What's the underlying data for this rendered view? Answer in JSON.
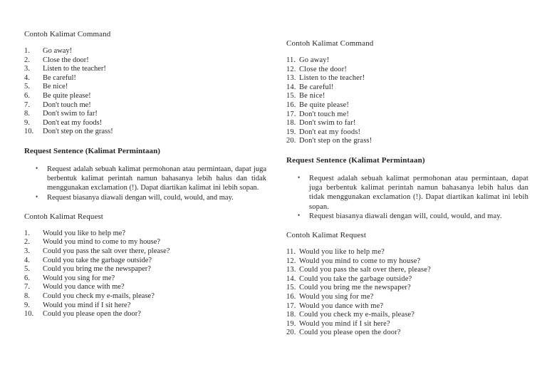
{
  "document": {
    "background_color": "#ffffff",
    "text_color": "#262626"
  },
  "columns": [
    {
      "id": "left",
      "command_heading": "Contoh Kalimat Command",
      "command_items": [
        {
          "number": "1.",
          "text": "Go away!"
        },
        {
          "number": "2.",
          "text": "Close the door!"
        },
        {
          "number": "3.",
          "text": "Listen to the teacher!"
        },
        {
          "number": "4.",
          "text": "Be careful!"
        },
        {
          "number": "5.",
          "text": "Be nice!"
        },
        {
          "number": "6.",
          "text": "Be quite please!"
        },
        {
          "number": "7.",
          "text": "Don't touch me!"
        },
        {
          "number": "8.",
          "text": "Don't swim to far!"
        },
        {
          "number": "9.",
          "text": "Don't eat my foods!"
        },
        {
          "number": "10.",
          "text": "Don't step on the grass!"
        }
      ],
      "request_heading": "Request Sentence (Kalimat Permintaan)",
      "request_bullets": [
        "Request adalah sebuah kalimat permohonan atau permintaan, dapat juga berbentuk kalimat perintah namun bahasanya lebih halus dan tidak menggunakan exclamation (!). Dapat diartikan kalimat ini lebih sopan.",
        "Request biasanya diawali dengan will, could, would, and may."
      ],
      "request_examples_heading": "Contoh Kalimat Request",
      "request_items": [
        {
          "number": "1.",
          "text": "Would you like to help me?"
        },
        {
          "number": "2.",
          "text": "Would you mind to come to my house?"
        },
        {
          "number": "3.",
          "text": "Could you pass the salt over there, please?"
        },
        {
          "number": "4.",
          "text": "Could you take the garbage outside?"
        },
        {
          "number": "5.",
          "text": "Could you bring me the newspaper?"
        },
        {
          "number": "6.",
          "text": "Would you sing for me?"
        },
        {
          "number": "7.",
          "text": "Would you dance with me?"
        },
        {
          "number": "8.",
          "text": "Could you check my e-mails, please?"
        },
        {
          "number": "9.",
          "text": "Would you mind if I sit here?"
        },
        {
          "number": "10.",
          "text": "Could you please open the door?"
        }
      ]
    },
    {
      "id": "right",
      "command_heading": "Contoh Kalimat Command",
      "command_items": [
        {
          "number": "11.",
          "text": "Go away!"
        },
        {
          "number": "12.",
          "text": "Close the door!"
        },
        {
          "number": "13.",
          "text": "Listen to the teacher!"
        },
        {
          "number": "14.",
          "text": "Be careful!"
        },
        {
          "number": "15.",
          "text": "Be nice!"
        },
        {
          "number": "16.",
          "text": "Be quite please!"
        },
        {
          "number": "17.",
          "text": "Don't touch me!"
        },
        {
          "number": "18.",
          "text": "Don't swim to far!"
        },
        {
          "number": "19.",
          "text": "Don't eat my foods!"
        },
        {
          "number": "20.",
          "text": "Don't step on the grass!"
        }
      ],
      "request_heading": "Request Sentence (Kalimat Permintaan)",
      "request_bullets": [
        "Request adalah sebuah kalimat permohonan atau permintaan, dapat juga berbentuk kalimat perintah namun bahasanya lebih halus dan tidak menggunakan exclamation (!). Dapat diartikan kalimat ini lebih sopan.",
        "Request biasanya diawali dengan will, could, would, and may."
      ],
      "request_examples_heading": "Contoh Kalimat Request",
      "request_items": [
        {
          "number": "11.",
          "text": "Would you like to help me?"
        },
        {
          "number": "12.",
          "text": "Would you mind to come to my house?"
        },
        {
          "number": "13.",
          "text": "Could you pass the salt over there, please?"
        },
        {
          "number": "14.",
          "text": "Could you take the garbage outside?"
        },
        {
          "number": "15.",
          "text": "Could you bring me the newspaper?"
        },
        {
          "number": "16.",
          "text": "Would you sing for me?"
        },
        {
          "number": "17.",
          "text": "Would you dance with me?"
        },
        {
          "number": "18.",
          "text": "Could you check my e-mails, please?"
        },
        {
          "number": "19.",
          "text": "Would you mind if I sit here?"
        },
        {
          "number": "20.",
          "text": "Could you please open the door?"
        }
      ]
    }
  ]
}
